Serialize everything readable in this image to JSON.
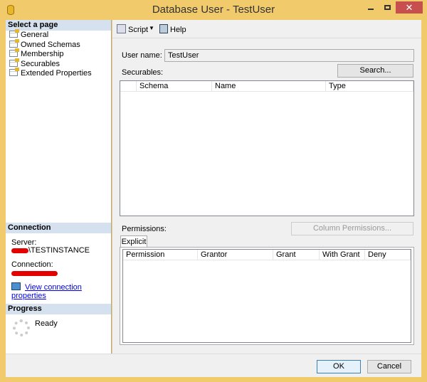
{
  "window": {
    "title": "Database User - TestUser",
    "close": "✕"
  },
  "select_page": {
    "header": "Select a page",
    "items": [
      {
        "label": "General"
      },
      {
        "label": "Owned Schemas"
      },
      {
        "label": "Membership"
      },
      {
        "label": "Securables"
      },
      {
        "label": "Extended Properties"
      }
    ]
  },
  "connection": {
    "header": "Connection",
    "server_label": "Server:",
    "server_value": "\\TESTINSTANCE",
    "connection_label": "Connection:",
    "view_link": "View connection properties"
  },
  "progress": {
    "header": "Progress",
    "status": "Ready"
  },
  "toolbar": {
    "script": "Script",
    "help": "Help"
  },
  "form": {
    "user_name_label": "User name:",
    "user_name_value": "TestUser",
    "securables_label": "Securables:",
    "search_button": "Search...",
    "securables_columns": [
      "Schema",
      "Name",
      "Type"
    ],
    "permissions_label": "Permissions:",
    "column_permissions_button": "Column Permissions...",
    "tab_explicit": "Explicit",
    "permissions_columns": [
      "Permission",
      "Grantor",
      "Grant",
      "With Grant",
      "Deny"
    ]
  },
  "buttons": {
    "ok": "OK",
    "cancel": "Cancel"
  }
}
